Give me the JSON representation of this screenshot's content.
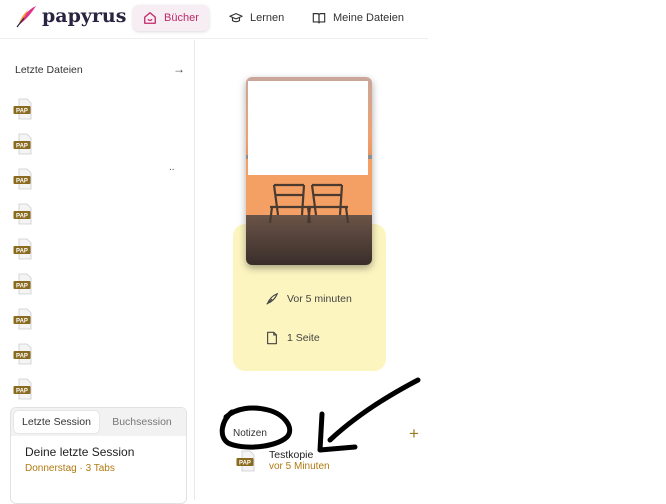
{
  "app": {
    "name": "papyrus"
  },
  "nav": [
    {
      "label": "Bücher",
      "icon": "home-icon",
      "active": true
    },
    {
      "label": "Lernen",
      "icon": "graduation-cap-icon",
      "active": false
    },
    {
      "label": "Meine Dateien",
      "icon": "book-icon",
      "active": false
    }
  ],
  "sidebar": {
    "recent_title": "Letzte Dateien",
    "file_badge": "PAP",
    "overflow_marker": ".."
  },
  "session": {
    "tabs": [
      "Letzte Session",
      "Buchsession"
    ],
    "title": "Deine letzte Session",
    "subtitle": "Donnerstag · 3 Tabs"
  },
  "book": {
    "edited": "Vor 5 minuten",
    "pages": "1 Seite"
  },
  "notes": {
    "label": "Notizen",
    "items": [
      {
        "title": "Testkopie",
        "subtitle": "vor 5 Minuten",
        "badge": "PAP"
      }
    ]
  },
  "colors": {
    "accent": "#c0286a",
    "gold": "#b07a10",
    "card": "#fdf5c0"
  }
}
